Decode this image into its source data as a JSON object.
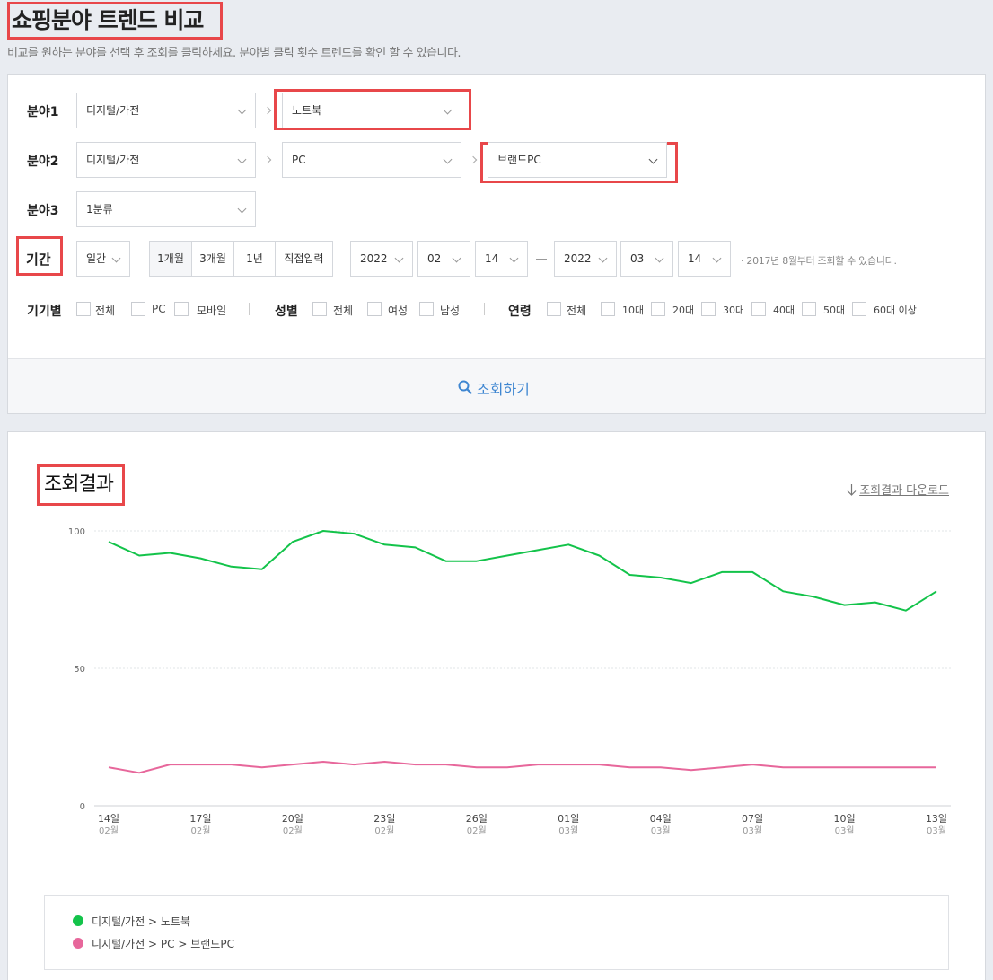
{
  "header": {
    "title": "쇼핑분야 트렌드 비교",
    "subtitle": "비교를 원하는 분야를 선택 후 조회를 클릭하세요. 분야별 클릭 횟수 트렌드를 확인 할 수 있습니다."
  },
  "filters": {
    "category1": {
      "label": "분야1",
      "level1": "디지털/가전",
      "level2": "노트북"
    },
    "category2": {
      "label": "분야2",
      "level1": "디지털/가전",
      "level2": "PC",
      "level3": "브랜드PC"
    },
    "category3": {
      "label": "분야3",
      "level1": "1분류"
    },
    "period": {
      "label": "기간",
      "unit": "일간",
      "buttons": [
        "1개월",
        "3개월",
        "1년",
        "직접입력"
      ],
      "start": {
        "year": "2022",
        "month": "02",
        "day": "14"
      },
      "end": {
        "year": "2022",
        "month": "03",
        "day": "14"
      },
      "note": "· 2017년 8월부터 조회할 수 있습니다."
    },
    "device": {
      "label": "기기별",
      "options": [
        "전체",
        "PC",
        "모바일"
      ]
    },
    "gender": {
      "label": "성별",
      "options": [
        "전체",
        "여성",
        "남성"
      ]
    },
    "age": {
      "label": "연령",
      "options": [
        "전체",
        "10대",
        "20대",
        "30대",
        "40대",
        "50대",
        "60대 이상"
      ]
    },
    "search_label": "조회하기"
  },
  "result": {
    "title": "조회결과",
    "download_label": "조회결과 다운로드"
  },
  "colors": {
    "accent": "#3e86d1",
    "highlight": "#e8474a",
    "series1": "#13c34a",
    "series2": "#e7679b"
  },
  "icons": [
    "search-icon",
    "download-icon",
    "chevron-down-icon",
    "chevron-right-icon"
  ],
  "chart_data": {
    "type": "line",
    "ylim": [
      0,
      100
    ],
    "yticks": [
      "100",
      "50",
      "0"
    ],
    "x": [
      "2022-02-14",
      "2022-02-15",
      "2022-02-16",
      "2022-02-17",
      "2022-02-18",
      "2022-02-19",
      "2022-02-20",
      "2022-02-21",
      "2022-02-22",
      "2022-02-23",
      "2022-02-24",
      "2022-02-25",
      "2022-02-26",
      "2022-02-27",
      "2022-02-28",
      "2022-03-01",
      "2022-03-02",
      "2022-03-03",
      "2022-03-04",
      "2022-03-05",
      "2022-03-06",
      "2022-03-07",
      "2022-03-08",
      "2022-03-09",
      "2022-03-10",
      "2022-03-11",
      "2022-03-12",
      "2022-03-13"
    ],
    "xticks": [
      {
        "day": "14일",
        "month": "02월",
        "index": 0
      },
      {
        "day": "17일",
        "month": "02월",
        "index": 3
      },
      {
        "day": "20일",
        "month": "02월",
        "index": 6
      },
      {
        "day": "23일",
        "month": "02월",
        "index": 9
      },
      {
        "day": "26일",
        "month": "02월",
        "index": 12
      },
      {
        "day": "01일",
        "month": "03월",
        "index": 15
      },
      {
        "day": "04일",
        "month": "03월",
        "index": 18
      },
      {
        "day": "07일",
        "month": "03월",
        "index": 21
      },
      {
        "day": "10일",
        "month": "03월",
        "index": 24
      },
      {
        "day": "13일",
        "month": "03월",
        "index": 27
      }
    ],
    "series": [
      {
        "name": "디지털/가전 > 노트북",
        "color": "#13c34a",
        "values": [
          96,
          91,
          92,
          90,
          87,
          86,
          96,
          100,
          99,
          95,
          94,
          89,
          89,
          91,
          93,
          95,
          91,
          84,
          83,
          81,
          85,
          85,
          78,
          76,
          73,
          74,
          71,
          78
        ]
      },
      {
        "name": "디지털/가전 > PC > 브랜드PC",
        "color": "#e7679b",
        "values": [
          14,
          12,
          15,
          15,
          15,
          14,
          15,
          16,
          15,
          16,
          15,
          15,
          14,
          14,
          15,
          15,
          15,
          14,
          14,
          13,
          14,
          15,
          14,
          14,
          14,
          14,
          14,
          14
        ]
      }
    ]
  }
}
